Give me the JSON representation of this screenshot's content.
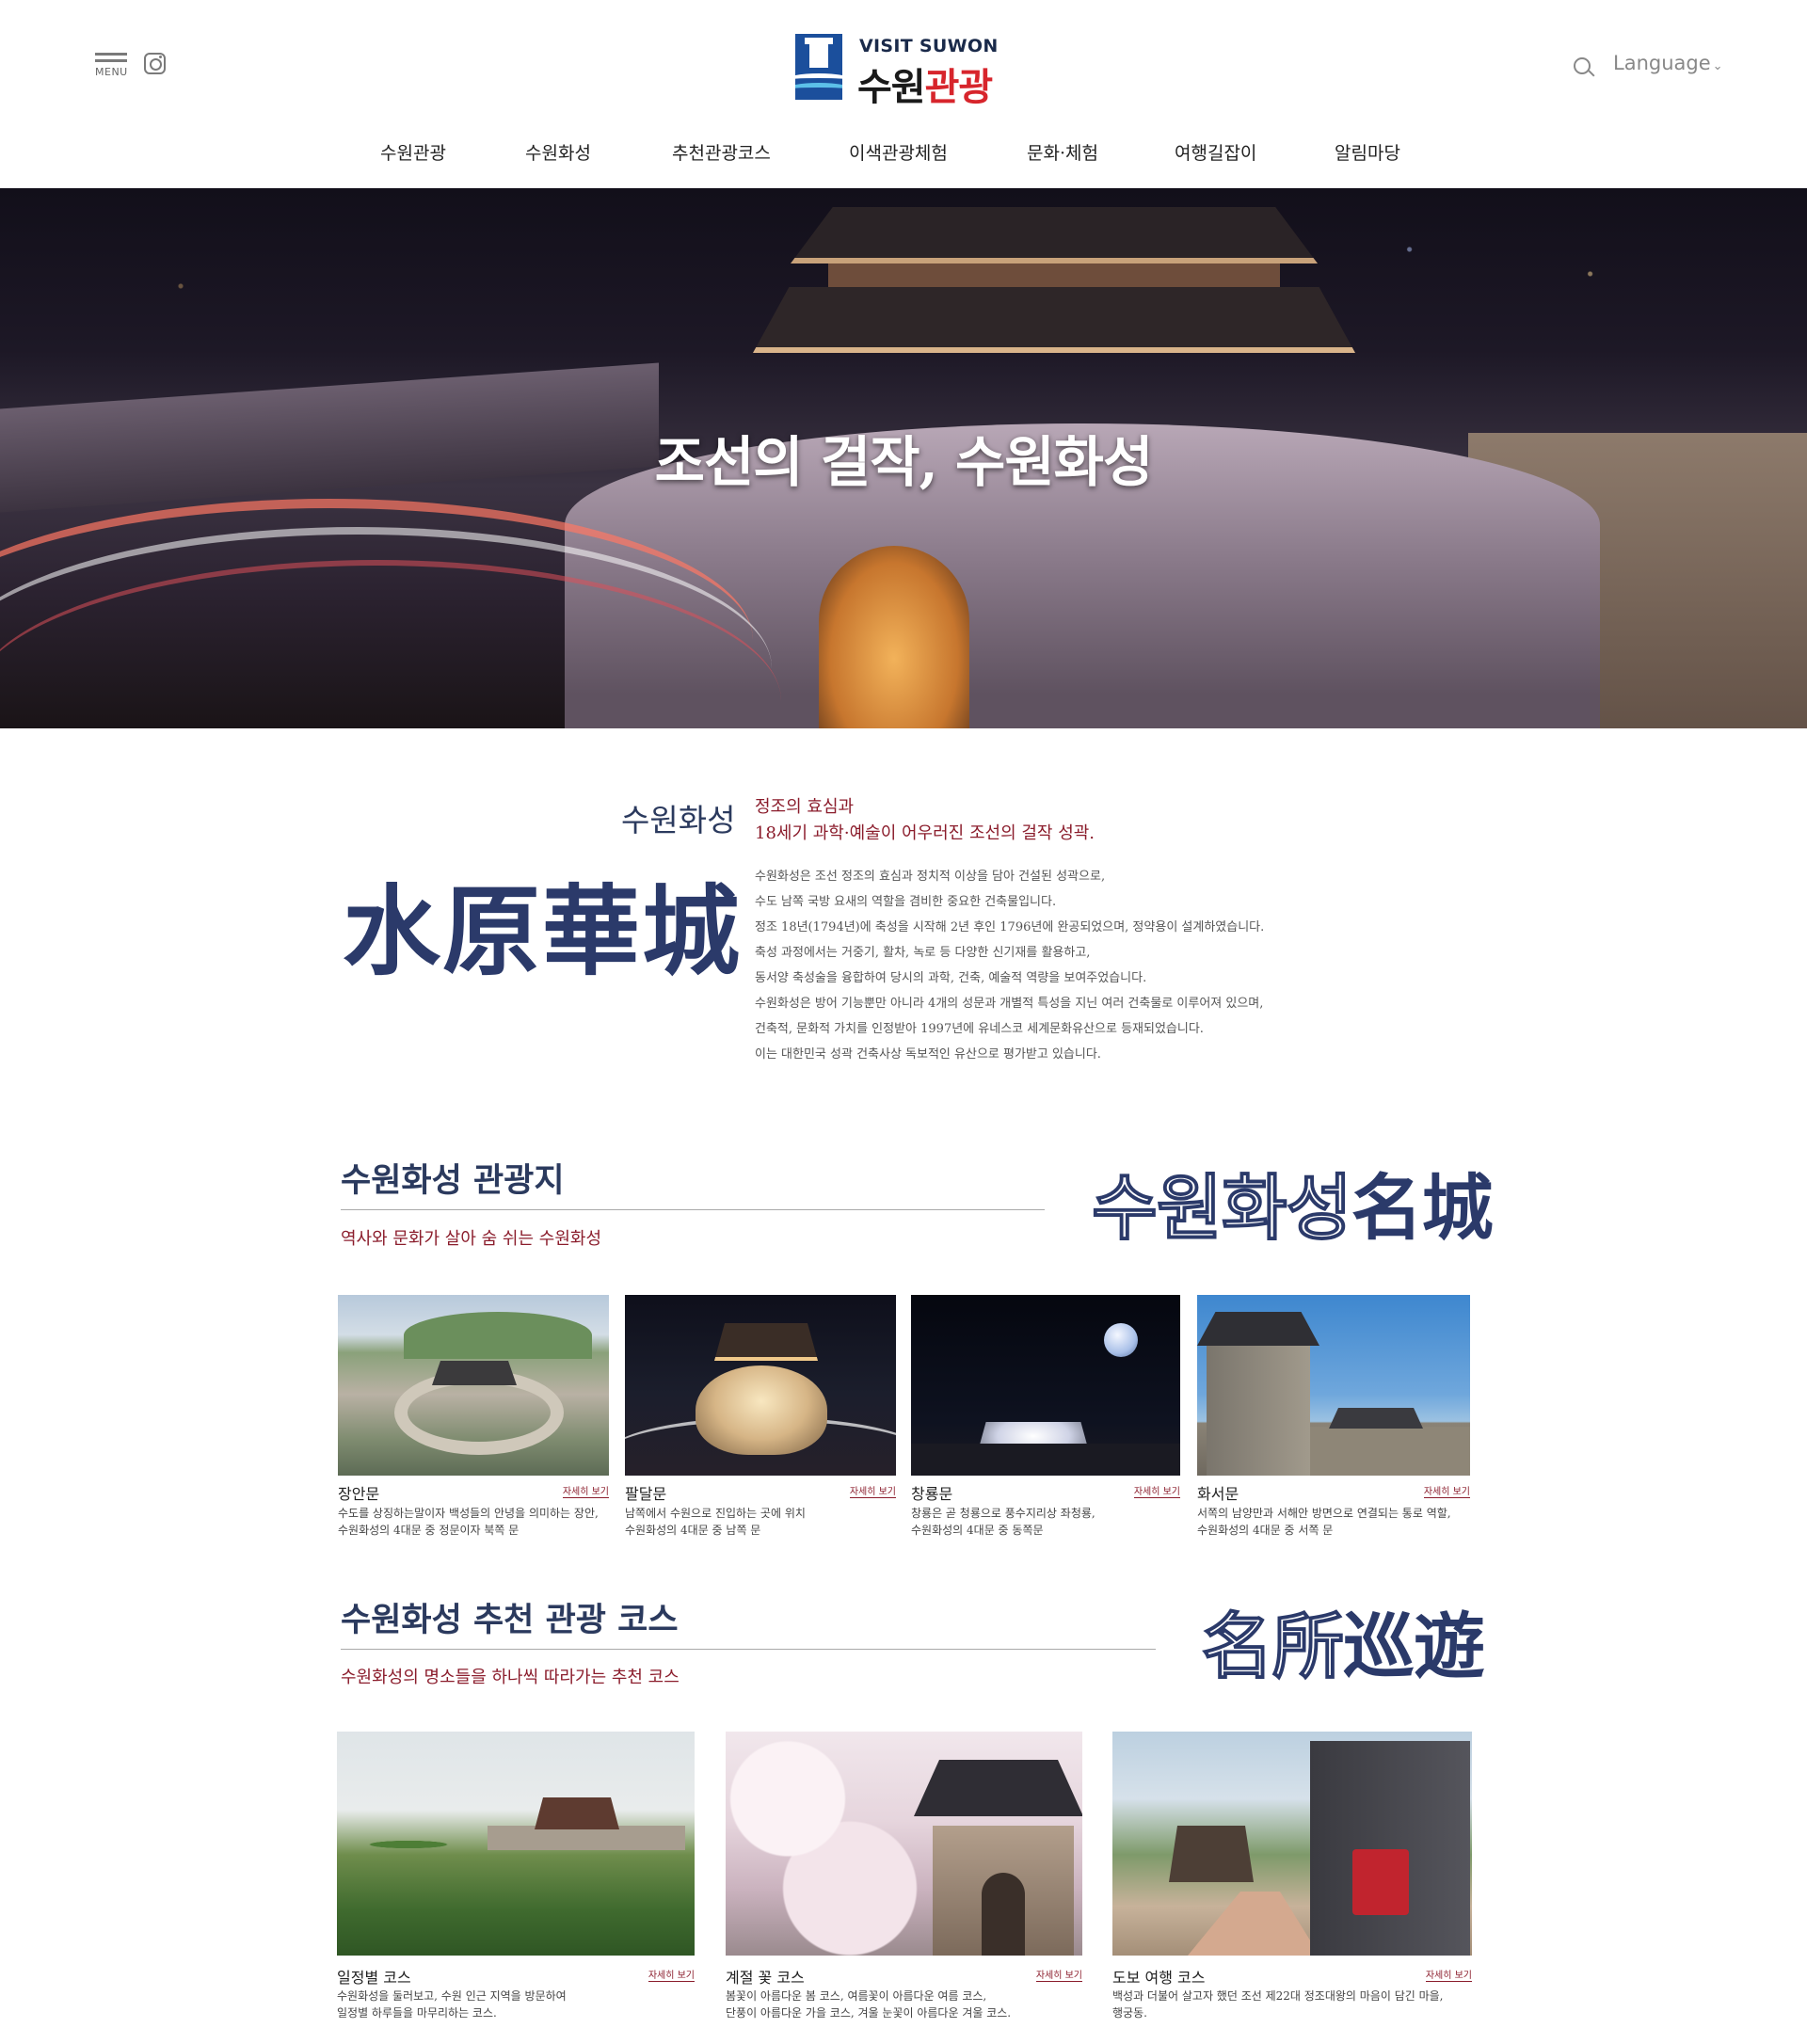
{
  "header": {
    "menu_label": "MENU",
    "logo_en": "VISIT SUWON",
    "logo_ko_main": "수원",
    "logo_ko_accent": "관광",
    "language_label": "Language",
    "gnb": [
      "수원관광",
      "수원화성",
      "추천관광코스",
      "이색관광체험",
      "문화·체험",
      "여행길잡이",
      "알림마당"
    ]
  },
  "hero": {
    "title": "조선의 걸작, 수원화성"
  },
  "intro": {
    "kicker": "수원화성",
    "hanja": "水原華城",
    "subtitle_line1": "정조의 효심과",
    "subtitle_line2": "18세기 과학·예술이 어우러진 조선의 걸작 성곽.",
    "body": [
      "수원화성은 조선 정조의 효심과 정치적 이상을 담아 건설된 성곽으로,",
      "수도 남쪽 국방 요새의 역할을 겸비한 중요한 건축물입니다.",
      "정조 18년(1794년)에 축성을 시작해 2년 후인 1796년에 완공되었으며, 정약용이 설계하였습니다.",
      "축성 과정에서는 거중기, 활차, 녹로 등 다양한 신기재를 활용하고,",
      "동서양 축성술을 융합하여 당시의 과학, 건축, 예술적 역량을 보여주었습니다.",
      "수원화성은 방어 기능뿐만 아니라 4개의 성문과 개별적 특성을 지닌 여러 건축물로 이루어져 있으며,",
      "건축적, 문화적 가치를 인정받아 1997년에 유네스코 세계문화유산으로 등재되었습니다.",
      "이는 대한민국 성곽 건축사상 독보적인 유산으로 평가받고 있습니다."
    ]
  },
  "attractions": {
    "title": "수원화성 관광지",
    "subtitle": "역사와 문화가 살아 숨 쉬는 수원화성",
    "deco_outline": "수원화성",
    "deco_solid": "名城",
    "more_label": "자세히 보기",
    "items": [
      {
        "name": "장안문",
        "desc1": "수도를 상징하는말이자 백성들의 안녕을 의미하는 장안,",
        "desc2": "수원화성의 4대문 중 정문이자 북쪽 문"
      },
      {
        "name": "팔달문",
        "desc1": "남쪽에서 수원으로 진입하는 곳에 위치",
        "desc2": "수원화성의 4대문 중 남쪽 문"
      },
      {
        "name": "창룡문",
        "desc1": "창룡은 곧 청룡으로 풍수지리상 좌청룡,",
        "desc2": "수원화성의 4대문 중 동쪽문"
      },
      {
        "name": "화서문",
        "desc1": "서쪽의 남양만과 서해안 방면으로 연결되는 통로 역할,",
        "desc2": "수원화성의 4대문 중 서쪽 문"
      }
    ]
  },
  "courses": {
    "title": "수원화성 추천 관광 코스",
    "subtitle": "수원화성의 명소들을 하나씩 따라가는 추천 코스",
    "deco_outline": "名所",
    "deco_solid": "巡遊",
    "more_label": "자세히 보기",
    "items": [
      {
        "name": "일정별 코스",
        "desc1": "수원화성을 둘러보고, 수원 인근 지역을 방문하여",
        "desc2": "일정별 하루들을 마무리하는 코스."
      },
      {
        "name": "계절 꽃 코스",
        "desc1": "봄꽃이 아름다운 봄 코스, 여름꽃이 아름다운 여름 코스,",
        "desc2": "단풍이 아름다운 가을 코스, 겨울 눈꽃이 아름다운 겨울 코스."
      },
      {
        "name": "도보 여행 코스",
        "desc1": "백성과 더불어 살고자 했던 조선 제22대 정조대왕의 마음이 담긴 마을,",
        "desc2": "행궁동."
      }
    ]
  },
  "colors": {
    "navy": "#2b3a5e",
    "accent_red": "#8b1d2c",
    "logo_blue": "#1b4f9c",
    "logo_red": "#d7252c"
  },
  "icons": [
    "menu-icon",
    "instagram-icon",
    "search-icon",
    "chevron-down-icon"
  ]
}
